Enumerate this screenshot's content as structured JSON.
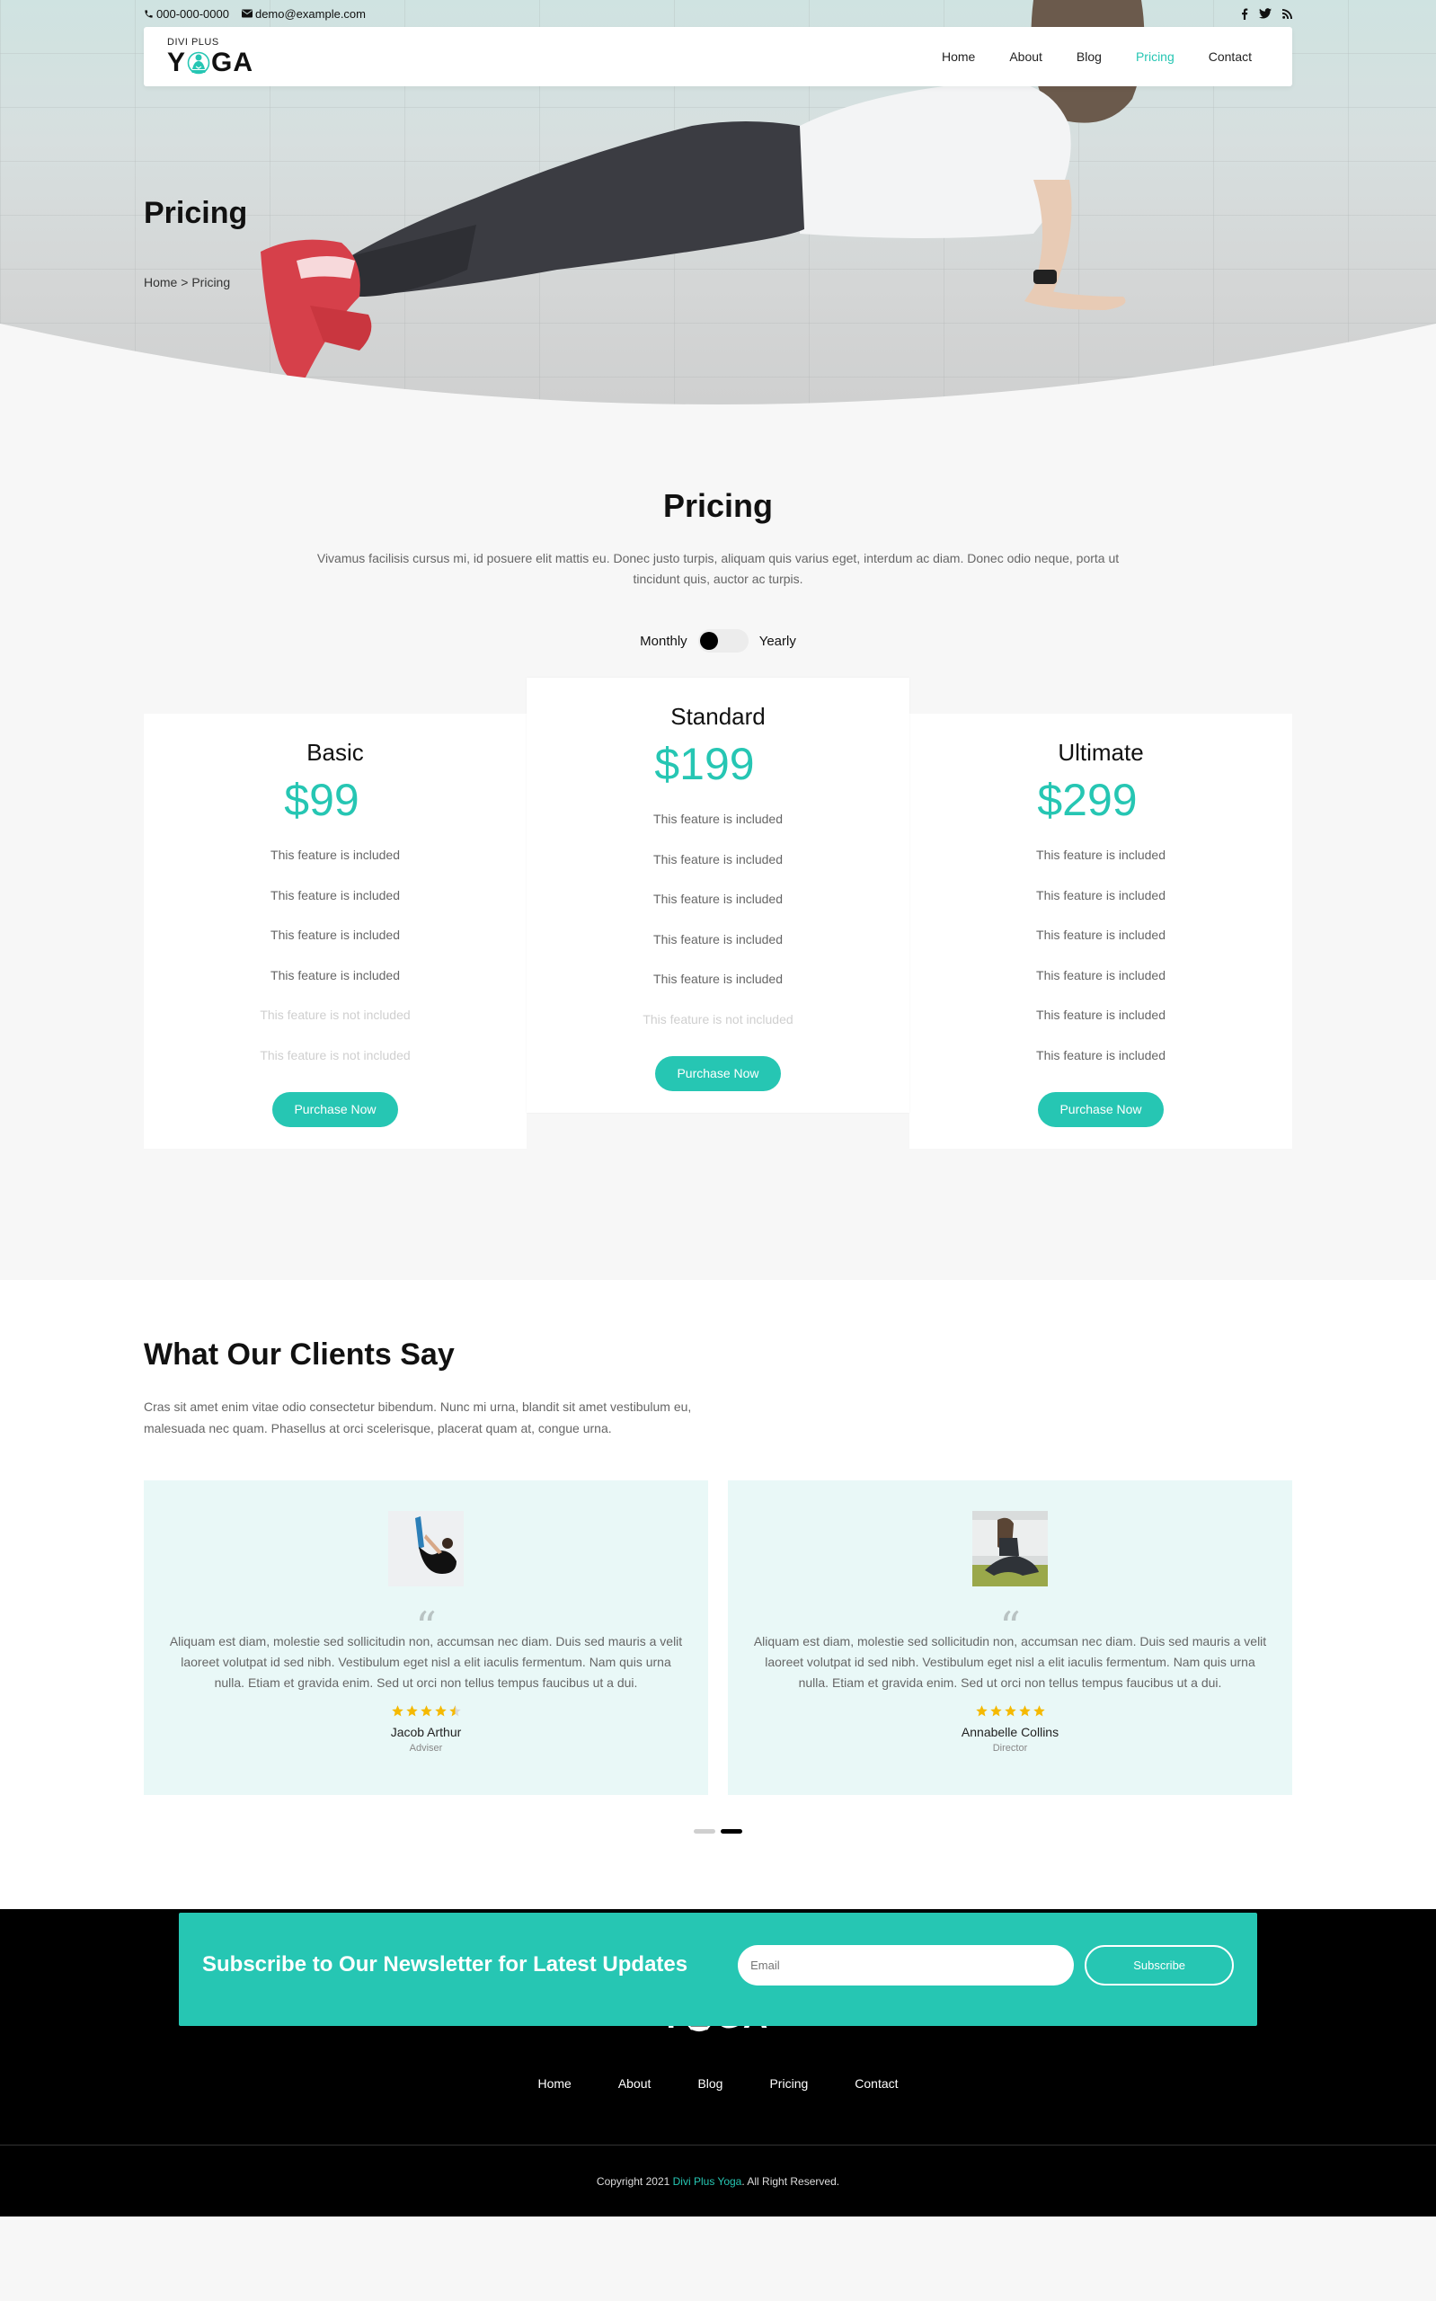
{
  "colors": {
    "accent": "#26c6b3",
    "star": "#f5b900",
    "footer_bg": "#000000",
    "testimonial_bg": "#e9f8f7"
  },
  "topbar": {
    "phone": "000-000-0000",
    "email": "demo@example.com",
    "social": [
      "facebook-icon",
      "twitter-icon",
      "rss-icon"
    ]
  },
  "logo": {
    "small": "DIVI PLUS",
    "big_left": "Y",
    "big_right": "GA"
  },
  "nav": {
    "items": [
      {
        "label": "Home",
        "active": false
      },
      {
        "label": "About",
        "active": false
      },
      {
        "label": "Blog",
        "active": false
      },
      {
        "label": "Pricing",
        "active": true
      },
      {
        "label": "Contact",
        "active": false
      }
    ]
  },
  "hero": {
    "title": "Pricing",
    "breadcrumb": {
      "home": "Home",
      "separator": ">",
      "current": "Pricing"
    }
  },
  "pricing": {
    "title": "Pricing",
    "description": "Vivamus facilisis cursus mi, id posuere elit mattis eu. Donec justo turpis, aliquam quis varius eget, interdum ac diam. Donec odio neque, porta ut tincidunt quis, auctor ac turpis.",
    "toggle": {
      "left": "Monthly",
      "right": "Yearly",
      "selected": "Monthly"
    },
    "plans": [
      {
        "name": "Basic",
        "price": "$99",
        "features": [
          {
            "text": "This feature is included",
            "included": true
          },
          {
            "text": "This feature is included",
            "included": true
          },
          {
            "text": "This feature is included",
            "included": true
          },
          {
            "text": "This feature is included",
            "included": true
          },
          {
            "text": "This feature is not included",
            "included": false
          },
          {
            "text": "This feature is not included",
            "included": false
          }
        ],
        "button": "Purchase Now"
      },
      {
        "name": "Standard",
        "price": "$199",
        "features": [
          {
            "text": "This feature is included",
            "included": true
          },
          {
            "text": "This feature is included",
            "included": true
          },
          {
            "text": "This feature is included",
            "included": true
          },
          {
            "text": "This feature is included",
            "included": true
          },
          {
            "text": "This feature is included",
            "included": true
          },
          {
            "text": "This feature is not included",
            "included": false
          }
        ],
        "button": "Purchase Now"
      },
      {
        "name": "Ultimate",
        "price": "$299",
        "features": [
          {
            "text": "This feature is included",
            "included": true
          },
          {
            "text": "This feature is included",
            "included": true
          },
          {
            "text": "This feature is included",
            "included": true
          },
          {
            "text": "This feature is included",
            "included": true
          },
          {
            "text": "This feature is included",
            "included": true
          },
          {
            "text": "This feature is included",
            "included": true
          }
        ],
        "button": "Purchase Now"
      }
    ]
  },
  "testimonials": {
    "title": "What Our Clients Say",
    "description": "Cras sit amet enim vitae odio consectetur bibendum. Nunc mi urna, blandit sit amet vestibulum eu, malesuada nec quam. Phasellus at orci scelerisque, placerat quam at, congue urna.",
    "items": [
      {
        "quote_mark": "“",
        "text": "Aliquam est diam, molestie sed sollicitudin non, accumsan nec diam. Duis sed mauris a velit laoreet volutpat id sed nibh. Vestibulum eget nisl a elit iaculis fermentum. Nam quis urna nulla. Etiam et gravida enim. Sed ut orci non tellus tempus faucibus ut a dui.",
        "rating": 4.5,
        "name": "Jacob Arthur",
        "role": "Adviser"
      },
      {
        "quote_mark": "“",
        "text": "Aliquam est diam, molestie sed sollicitudin non, accumsan nec diam. Duis sed mauris a velit laoreet volutpat id sed nibh. Vestibulum eget nisl a elit iaculis fermentum. Nam quis urna nulla. Etiam et gravida enim. Sed ut orci non tellus tempus faucibus ut a dui.",
        "rating": 5,
        "name": "Annabelle Collins",
        "role": "Director"
      }
    ],
    "slider": {
      "count": 2,
      "active_index": 1
    }
  },
  "newsletter": {
    "title": "Subscribe to Our Newsletter for Latest Updates",
    "email_placeholder": "Email",
    "email_value": "",
    "button": "Subscribe"
  },
  "footer": {
    "nav": [
      "Home",
      "About",
      "Blog",
      "Pricing",
      "Contact"
    ],
    "copyright_prefix": "Copyright 2021 ",
    "copyright_brand": "Divi Plus Yoga",
    "copyright_suffix": ". All Right Reserved."
  }
}
